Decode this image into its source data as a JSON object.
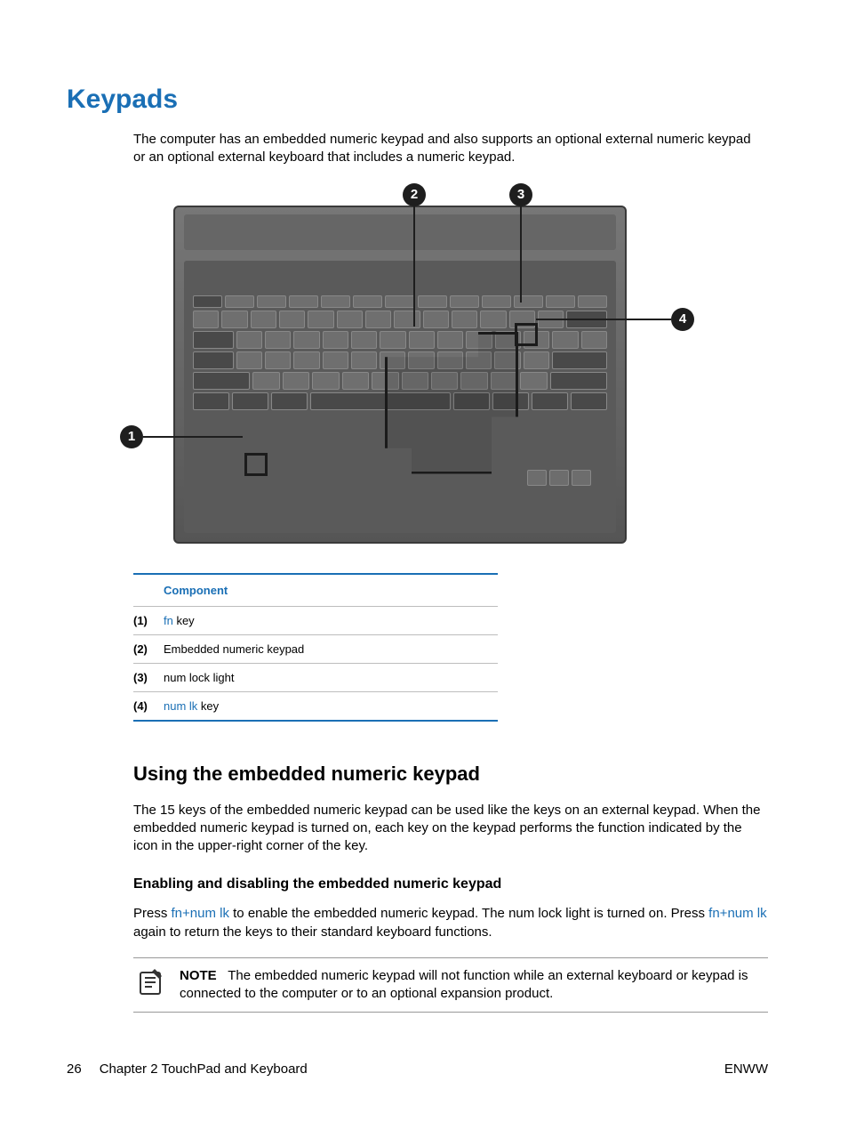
{
  "heading": "Keypads",
  "intro": "The computer has an embedded numeric keypad and also supports an optional external numeric keypad or an optional external keyboard that includes a numeric keypad.",
  "callouts": [
    "1",
    "2",
    "3",
    "4"
  ],
  "table": {
    "header": "Component",
    "rows": [
      {
        "idx": "(1)",
        "kw": "fn",
        "rest": " key"
      },
      {
        "idx": "(2)",
        "kw": "",
        "rest": "Embedded numeric keypad"
      },
      {
        "idx": "(3)",
        "kw": "",
        "rest": "num lock light"
      },
      {
        "idx": "(4)",
        "kw": "num lk",
        "rest": " key"
      }
    ]
  },
  "section2": {
    "title": "Using the embedded numeric keypad",
    "para": "The 15 keys of the embedded numeric keypad can be used like the keys on an external keypad. When the embedded numeric keypad is turned on, each key on the keypad performs the function indicated by the icon in the upper-right corner of the key."
  },
  "section3": {
    "title": "Enabling and disabling the embedded numeric keypad",
    "p1a": "Press ",
    "p1kw1": "fn+num lk",
    "p1b": " to enable the embedded numeric keypad. The num lock light is turned on. Press ",
    "p1kw2": "fn+num lk",
    "p1c": " again to return the keys to their standard keyboard functions."
  },
  "note": {
    "label": "NOTE",
    "text": "The embedded numeric keypad will not function while an external keyboard or keypad is connected to the computer or to an optional expansion product."
  },
  "footer": {
    "page": "26",
    "chapter": "Chapter 2   TouchPad and Keyboard",
    "right": "ENWW"
  }
}
